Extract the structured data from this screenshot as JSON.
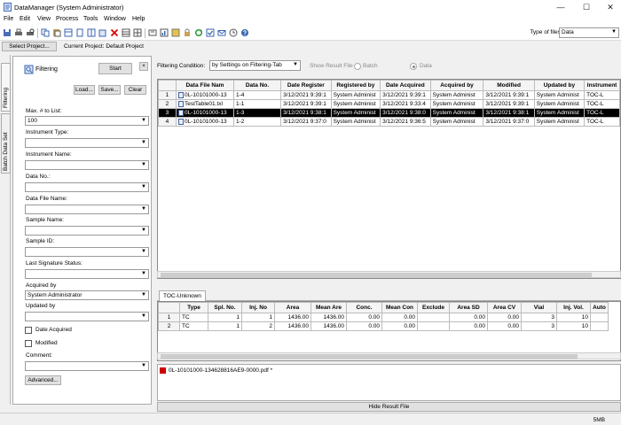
{
  "window": {
    "title": "DataManager (System Administrator)"
  },
  "menu": [
    "File",
    "Edit",
    "View",
    "Process",
    "Tools",
    "Window",
    "Help"
  ],
  "toolbar_icons": [
    "save-icon",
    "print-icon",
    "print-preview-icon",
    "copy-icon",
    "paste-icon",
    "delete-icon",
    "cut-icon",
    "table-icon",
    "columns-icon",
    "user-icon",
    "lock-icon",
    "sync-icon",
    "check-icon",
    "mail-icon",
    "clock-icon",
    "help-icon"
  ],
  "type_of_files": {
    "label": "Type of files",
    "value": "Data"
  },
  "project": {
    "select_label": "Select Project...",
    "current": "Current Project:  Default Project"
  },
  "side_tabs": {
    "filtering": "Filtering",
    "batch": "Batch Data Set"
  },
  "filter_panel": {
    "title": "Filtering",
    "start": "Start",
    "close": "×",
    "load": "Load...",
    "save": "Save...",
    "clear": "Clear",
    "max_label": "Max. # to List:",
    "max_value": "100",
    "instrument_type": "Instrument Type:",
    "instrument_name": "Instrument Name:",
    "data_no": "Data No.:",
    "data_file_name": "Data File Name:",
    "sample_name": "Sample Name:",
    "sample_id": "Sample ID:",
    "last_signature": "Last Signature Status:",
    "acquired_by": "Acquired by",
    "acquired_value": "System Administrator",
    "updated_by": "Updated by",
    "date_acquired": "Date Acquired",
    "modified": "Modified",
    "comment": "Comment:",
    "advanced": "Advanced..."
  },
  "filter_bar": {
    "label": "Filtering Condition:",
    "value": "by Settings on Filtering-Tab",
    "show_result": "Show Result File",
    "batch": "Batch",
    "data": "Data"
  },
  "main_table": {
    "headers": [
      "",
      "Data File Nam",
      "Data No.",
      "Date Register",
      "Registered by",
      "Date Acquired",
      "Acquired by",
      "Modified",
      "Updated by",
      "Instrument"
    ],
    "rows": [
      [
        "1",
        "0L-10101000-13",
        "1-4",
        "3/12/2021 9:39:1",
        "System Administ",
        "3/12/2021 9:39:1",
        "System Administ",
        "3/12/2021 9:39:1",
        "System Administ",
        "TOC-L"
      ],
      [
        "2",
        "TestTable01.txl",
        "1-1",
        "3/12/2021 9:39:1",
        "System Administ",
        "3/12/2021 9:33:4",
        "System Administ",
        "3/12/2021 9:39:1",
        "System Administ",
        "TOC-L"
      ],
      [
        "3",
        "0L-10101000-13",
        "1-3",
        "3/12/2021 9:38:1",
        "System Administ",
        "3/12/2021 9:38:0",
        "System Administ",
        "3/12/2021 9:38:1",
        "System Administ",
        "TOC-L"
      ],
      [
        "4",
        "0L-10101000-13",
        "1-2",
        "3/12/2021 9:37:0",
        "System Administ",
        "3/12/2021 9:36:5",
        "System Administ",
        "3/12/2021 9:37:0",
        "System Administ",
        "TOC-L"
      ]
    ],
    "selected_row": 2
  },
  "result_tab": "TOC-Unknown",
  "sub_table": {
    "headers": [
      "",
      "Type",
      "Spl. No.",
      "Inj. No",
      "Area",
      "Mean Are",
      "Conc.",
      "Mean Con",
      "Exclude",
      "Area SD",
      "Area CV",
      "Vial",
      "Inj. Vol.",
      "Auto"
    ],
    "rows": [
      [
        "1",
        "TC",
        "1",
        "1",
        "1436.00",
        "1436.00",
        "0.00",
        "0.00",
        "",
        "0.00",
        "0.00",
        "3",
        "10",
        ""
      ],
      [
        "2",
        "TC",
        "1",
        "2",
        "1436.00",
        "1436.00",
        "0.00",
        "0.00",
        "",
        "0.00",
        "0.00",
        "3",
        "10",
        ""
      ]
    ]
  },
  "result_file": "0L-10101000-134628816AE9-0000.pdf *",
  "hide_result": "Hide Result File",
  "status": {
    "memory": "5MB"
  }
}
